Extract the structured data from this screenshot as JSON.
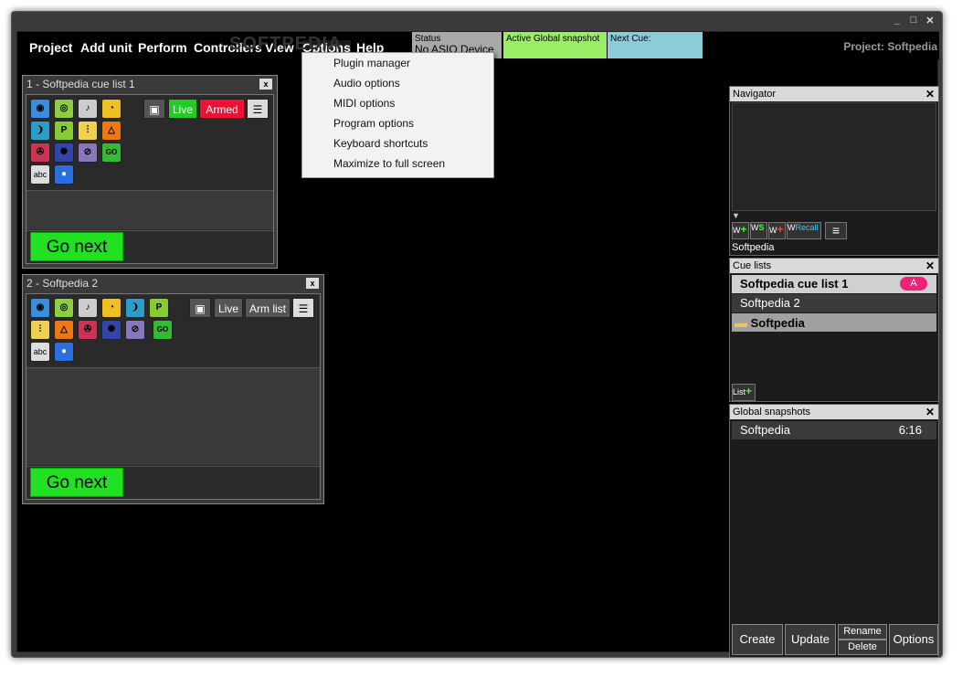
{
  "window": {
    "minimize": "_",
    "maximize": "□",
    "close": "✕"
  },
  "menubar": {
    "items": [
      "Project",
      "Add unit",
      "Perform",
      "Controllers",
      "View",
      "Options",
      "Help"
    ],
    "watermark": "SOFTPEDIA",
    "status_label": "Status",
    "status_value": "No ASIO Device",
    "snapshot_label": "Active Global snapshot",
    "nextcue_label": "Next Cue:",
    "project": "Project: Softpedia"
  },
  "options_menu": {
    "items": [
      "Plugin manager",
      "Audio options",
      "MIDI options",
      "Program options",
      "Keyboard shortcuts",
      "Maximize to full screen"
    ]
  },
  "cuelist1": {
    "title": "1 - Softpedia cue list 1",
    "close": "x",
    "live": "Live",
    "armed": "Armed",
    "go_next": "Go next",
    "abc": "abc",
    "go_icon": "GO",
    "p_icon": "P"
  },
  "cuelist2": {
    "title": "2 - Softpedia 2",
    "close": "x",
    "live": "Live",
    "armlist": "Arm list",
    "go_next": "Go next",
    "abc": "abc",
    "go_icon": "GO",
    "p_icon": "P"
  },
  "navigator": {
    "title": "Navigator",
    "close": "✕",
    "arrow": "▼",
    "btns": [
      "W",
      "W",
      "W",
      "W"
    ],
    "btn_subs": [
      "+",
      "S",
      "+",
      "Recall"
    ],
    "menu_icon": "≡",
    "label": "Softpedia"
  },
  "cue_lists": {
    "title": "Cue lists",
    "close": "✕",
    "rows": [
      "Softpedia cue list 1",
      "Softpedia 2",
      "Softpedia"
    ],
    "active_badge": "A",
    "list_btn": "List",
    "list_plus": "+"
  },
  "global_snapshots": {
    "title": "Global snapshots",
    "close": "✕",
    "row_name": "Softpedia",
    "row_key": "6:16",
    "create": "Create",
    "update": "Update",
    "rename": "Rename",
    "delete": "Delete",
    "options": "Options"
  },
  "colors": {
    "live_green": "#22cc22",
    "armed_red": "#ee1133",
    "snapshot_green": "#99ee66",
    "nextcue_blue": "#8ccbd8",
    "status_gray": "#a8a8a8",
    "go_green": "#22e022"
  }
}
